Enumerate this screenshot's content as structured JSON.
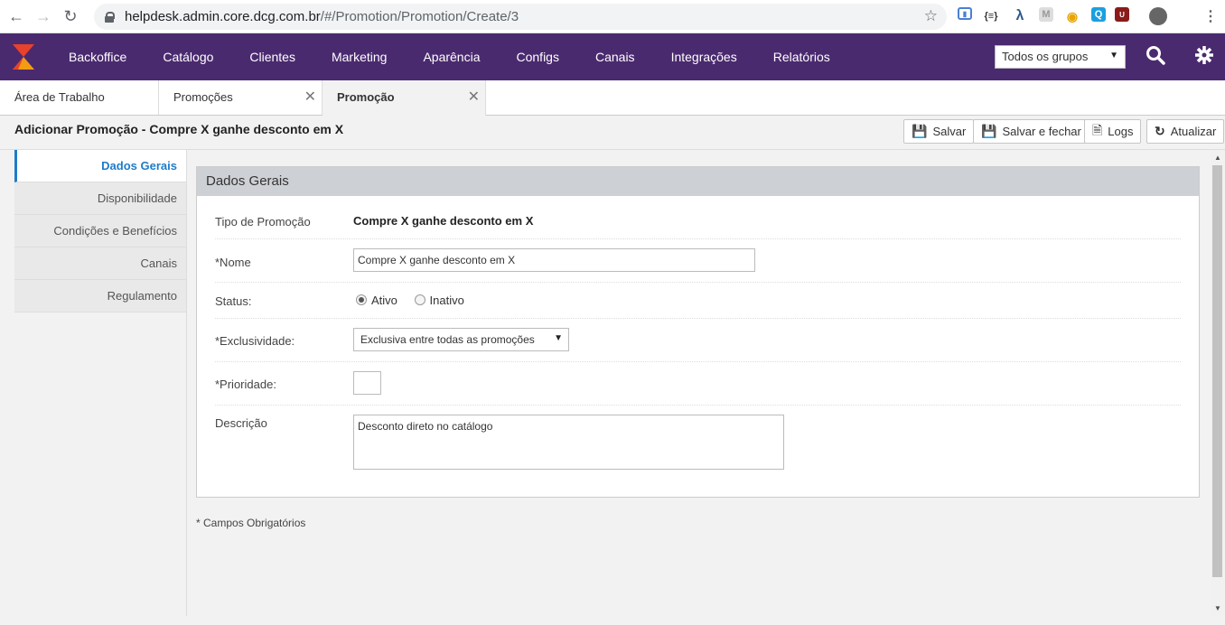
{
  "browser": {
    "url_host": "helpdesk.admin.core.dcg.com.br",
    "url_path": "/#/Promotion/Promotion/Create/3"
  },
  "nav": {
    "items": [
      "Backoffice",
      "Catálogo",
      "Clientes",
      "Marketing",
      "Aparência",
      "Configs",
      "Canais",
      "Integrações",
      "Relatórios"
    ],
    "group_select": "Todos os grupos"
  },
  "tabs": [
    {
      "label": "Área de Trabalho"
    },
    {
      "label": "Promoções"
    },
    {
      "label": "Promoção"
    }
  ],
  "page": {
    "title": "Adicionar Promoção - Compre X ganhe desconto em X",
    "buttons": {
      "save": "Salvar",
      "save_close": "Salvar e fechar",
      "logs": "Logs",
      "refresh": "Atualizar"
    }
  },
  "sidebar": {
    "items": [
      "Dados Gerais",
      "Disponibilidade",
      "Condições e Benefícios",
      "Canais",
      "Regulamento"
    ]
  },
  "form": {
    "panel_title": "Dados Gerais",
    "tipo_label": "Tipo de Promoção",
    "tipo_value": "Compre X ganhe desconto em X",
    "nome_label": "*Nome",
    "nome_value": "Compre X ganhe desconto em X",
    "status_label": "Status:",
    "status_ativo": "Ativo",
    "status_inativo": "Inativo",
    "exclusividade_label": "*Exclusividade:",
    "exclusividade_value": "Exclusiva entre todas as promoções",
    "prioridade_label": "*Prioridade:",
    "prioridade_value": "",
    "descricao_label": "Descrição",
    "descricao_value": "Desconto direto no catálogo"
  },
  "footnote": "* Campos Obrigatórios"
}
